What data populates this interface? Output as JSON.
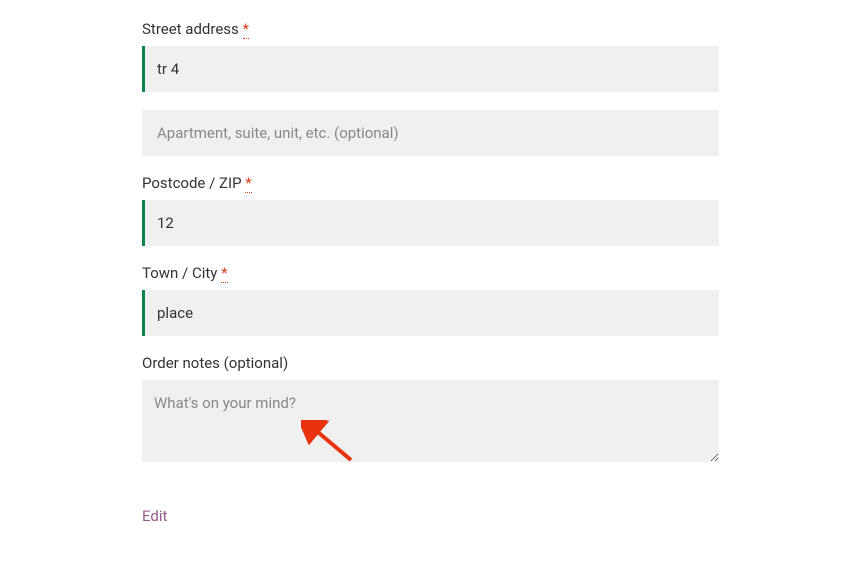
{
  "fields": {
    "street_address": {
      "label": "Street address",
      "required_marker": "*",
      "value": "tr 4"
    },
    "apartment": {
      "placeholder": "Apartment, suite, unit, etc. (optional)",
      "value": ""
    },
    "postcode": {
      "label": "Postcode / ZIP",
      "required_marker": "*",
      "value": "12"
    },
    "town": {
      "label": "Town / City",
      "required_marker": "*",
      "value": "place"
    },
    "order_notes": {
      "label": "Order notes (optional)",
      "placeholder": "What's on your mind?",
      "value": ""
    }
  },
  "links": {
    "edit": "Edit"
  }
}
